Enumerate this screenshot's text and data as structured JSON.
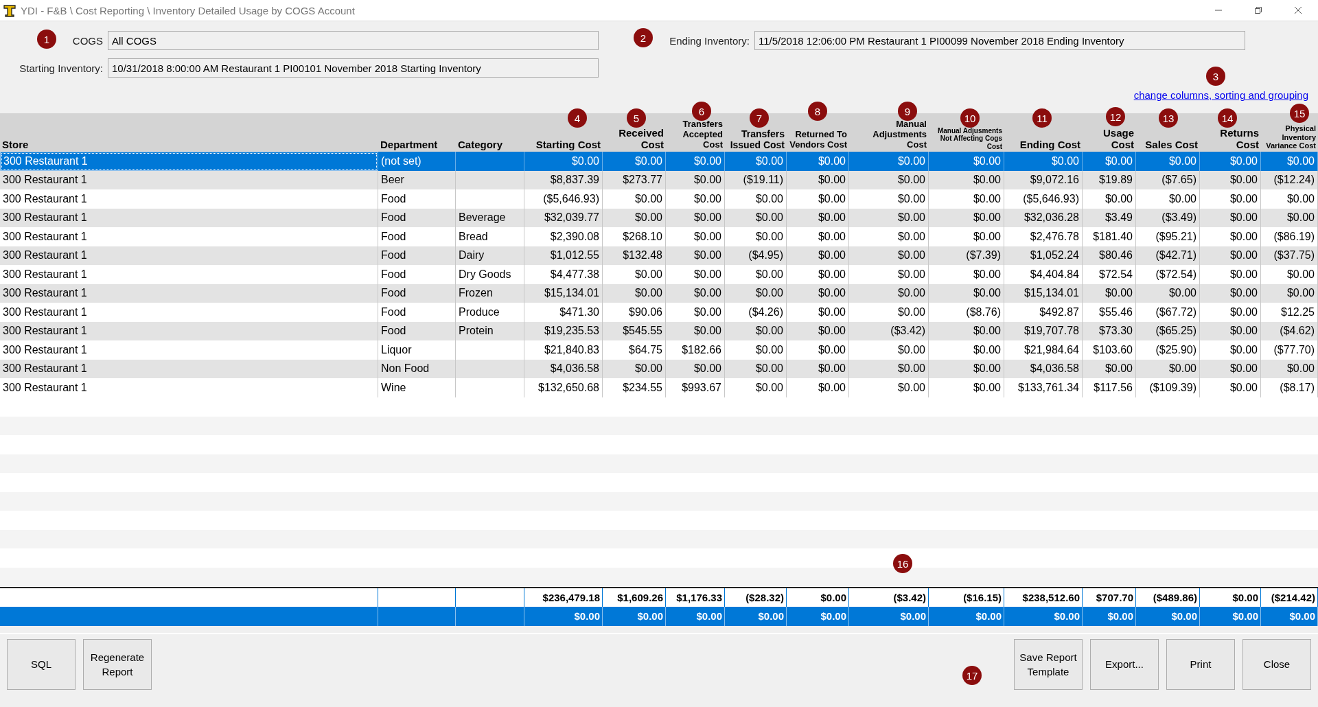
{
  "window": {
    "title": "YDI - F&B \\ Cost Reporting \\ Inventory Detailed Usage by COGS Account"
  },
  "filters": {
    "cogs": {
      "label": "COGS",
      "value": "All COGS"
    },
    "starting_inventory": {
      "label": "Starting Inventory:",
      "value": "10/31/2018 8:00:00 AM Restaurant 1 PI00101 November 2018 Starting Inventory"
    },
    "ending_inventory": {
      "label": "Ending Inventory:",
      "value": "11/5/2018 12:06:00 PM Restaurant 1 PI00099 November 2018 Ending Inventory"
    }
  },
  "link": "change columns, sorting and grouping",
  "table": {
    "columns": [
      "Store",
      "Department",
      "Category",
      "Starting Cost",
      "Received Cost",
      "Transfers Accepted Cost",
      "Transfers Issued Cost",
      "Returned To Vendors Cost",
      "Manual Adjustments Cost",
      "Manual Adjusments Not Affecting Cogs Cost",
      "Ending Cost",
      "Usage Cost",
      "Sales Cost",
      "Returns Cost",
      "Physical Inventory Variance Cost"
    ],
    "rows": [
      {
        "selected": true,
        "store": "300 Restaurant 1",
        "department": "(not set)",
        "values": [
          "$0.00",
          "$0.00",
          "$0.00",
          "$0.00",
          "$0.00",
          "$0.00",
          "$0.00",
          "$0.00",
          "$0.00",
          "$0.00",
          "$0.00",
          "$0.00"
        ]
      },
      {
        "selected": false,
        "store": "300 Restaurant 1",
        "department": "Beer",
        "values": [
          "$8,837.39",
          "$273.77",
          "$0.00",
          "($19.11)",
          "$0.00",
          "$0.00",
          "$0.00",
          "$9,072.16",
          "$19.89",
          "($7.65)",
          "$0.00",
          "($12.24)"
        ]
      },
      {
        "selected": false,
        "store": "300 Restaurant 1",
        "department": "Food",
        "values": [
          "($5,646.93)",
          "$0.00",
          "$0.00",
          "$0.00",
          "$0.00",
          "$0.00",
          "$0.00",
          "($5,646.93)",
          "$0.00",
          "$0.00",
          "$0.00",
          "$0.00"
        ]
      },
      {
        "selected": false,
        "store": "300 Restaurant 1",
        "department": "Food",
        "category": "Beverage",
        "values": [
          "$32,039.77",
          "$0.00",
          "$0.00",
          "$0.00",
          "$0.00",
          "$0.00",
          "$0.00",
          "$32,036.28",
          "$3.49",
          "($3.49)",
          "$0.00",
          "$0.00"
        ]
      },
      {
        "selected": false,
        "store": "300 Restaurant 1",
        "department": "Food",
        "category": "Bread",
        "values": [
          "$2,390.08",
          "$268.10",
          "$0.00",
          "$0.00",
          "$0.00",
          "$0.00",
          "$0.00",
          "$2,476.78",
          "$181.40",
          "($95.21)",
          "$0.00",
          "($86.19)"
        ]
      },
      {
        "selected": false,
        "store": "300 Restaurant 1",
        "department": "Food",
        "category": "Dairy",
        "values": [
          "$1,012.55",
          "$132.48",
          "$0.00",
          "($4.95)",
          "$0.00",
          "$0.00",
          "($7.39)",
          "$1,052.24",
          "$80.46",
          "($42.71)",
          "$0.00",
          "($37.75)"
        ]
      },
      {
        "selected": false,
        "store": "300 Restaurant 1",
        "department": "Food",
        "category": "Dry Goods",
        "values": [
          "$4,477.38",
          "$0.00",
          "$0.00",
          "$0.00",
          "$0.00",
          "$0.00",
          "$0.00",
          "$4,404.84",
          "$72.54",
          "($72.54)",
          "$0.00",
          "$0.00"
        ]
      },
      {
        "selected": false,
        "store": "300 Restaurant 1",
        "department": "Food",
        "category": "Frozen",
        "values": [
          "$15,134.01",
          "$0.00",
          "$0.00",
          "$0.00",
          "$0.00",
          "$0.00",
          "$0.00",
          "$15,134.01",
          "$0.00",
          "$0.00",
          "$0.00",
          "$0.00"
        ]
      },
      {
        "selected": false,
        "store": "300 Restaurant 1",
        "department": "Food",
        "category": "Produce",
        "values": [
          "$471.30",
          "$90.06",
          "$0.00",
          "($4.26)",
          "$0.00",
          "$0.00",
          "($8.76)",
          "$492.87",
          "$55.46",
          "($67.72)",
          "$0.00",
          "$12.25"
        ]
      },
      {
        "selected": false,
        "store": "300 Restaurant 1",
        "department": "Food",
        "category": "Protein",
        "values": [
          "$19,235.53",
          "$545.55",
          "$0.00",
          "$0.00",
          "$0.00",
          "($3.42)",
          "$0.00",
          "$19,707.78",
          "$73.30",
          "($65.25)",
          "$0.00",
          "($4.62)"
        ]
      },
      {
        "selected": false,
        "store": "300 Restaurant 1",
        "department": "Liquor",
        "values": [
          "$21,840.83",
          "$64.75",
          "$182.66",
          "$0.00",
          "$0.00",
          "$0.00",
          "$0.00",
          "$21,984.64",
          "$103.60",
          "($25.90)",
          "$0.00",
          "($77.70)"
        ]
      },
      {
        "selected": false,
        "store": "300 Restaurant 1",
        "department": "Non Food",
        "values": [
          "$4,036.58",
          "$0.00",
          "$0.00",
          "$0.00",
          "$0.00",
          "$0.00",
          "$0.00",
          "$4,036.58",
          "$0.00",
          "$0.00",
          "$0.00",
          "$0.00"
        ]
      },
      {
        "selected": false,
        "store": "300 Restaurant 1",
        "department": "Wine",
        "values": [
          "$132,650.68",
          "$234.55",
          "$993.67",
          "$0.00",
          "$0.00",
          "$0.00",
          "$0.00",
          "$133,761.34",
          "$117.56",
          "($109.39)",
          "$0.00",
          "($8.17)"
        ]
      }
    ],
    "totals": [
      {
        "selected": false,
        "values": [
          "$236,479.18",
          "$1,609.26",
          "$1,176.33",
          "($28.32)",
          "$0.00",
          "($3.42)",
          "($16.15)",
          "$238,512.60",
          "$707.70",
          "($489.86)",
          "$0.00",
          "($214.42)"
        ]
      },
      {
        "selected": true,
        "values": [
          "$0.00",
          "$0.00",
          "$0.00",
          "$0.00",
          "$0.00",
          "$0.00",
          "$0.00",
          "$0.00",
          "$0.00",
          "$0.00",
          "$0.00",
          "$0.00"
        ]
      }
    ]
  },
  "buttons": [
    "SQL",
    "Regenerate Report",
    "Save Report Template",
    "Export...",
    "Print",
    "Close"
  ],
  "annotations": [
    "1",
    "2",
    "3",
    "4",
    "5",
    "6",
    "7",
    "8",
    "9",
    "10",
    "11",
    "12",
    "13",
    "14",
    "15",
    "16",
    "17"
  ]
}
